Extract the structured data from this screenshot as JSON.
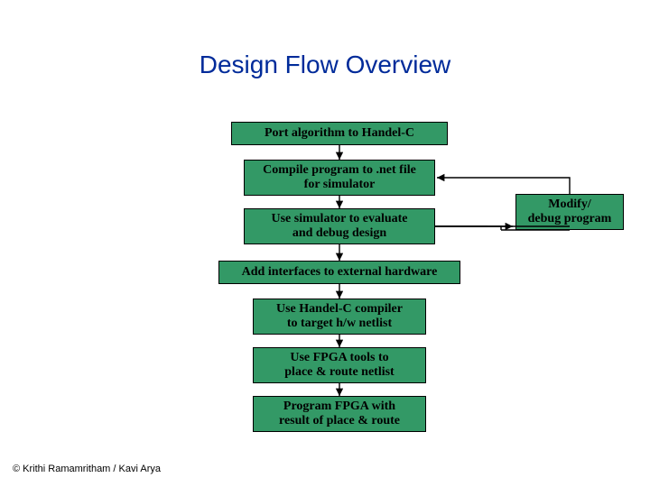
{
  "title": "Design Flow Overview",
  "steps": {
    "s1": "Port algorithm to Handel-C",
    "s2": "Compile program to .net file\nfor simulator",
    "s3": "Use simulator to evaluate\nand debug design",
    "s4": "Add interfaces to external hardware",
    "s5": "Use Handel-C compiler\nto target h/w netlist",
    "s6": "Use FPGA tools to\nplace & route netlist",
    "s7": "Program FPGA with\nresult of place & route"
  },
  "side": "Modify/\ndebug program",
  "footer": "© Krithi Ramamritham / Kavi Arya",
  "chart_data": {
    "type": "diagram",
    "title": "Design Flow Overview",
    "nodes": [
      {
        "id": "s1",
        "label": "Port algorithm to Handel-C"
      },
      {
        "id": "s2",
        "label": "Compile program to .net file for simulator"
      },
      {
        "id": "s3",
        "label": "Use simulator to evaluate and debug design"
      },
      {
        "id": "s4",
        "label": "Add interfaces to external hardware"
      },
      {
        "id": "s5",
        "label": "Use Handel-C compiler to target h/w netlist"
      },
      {
        "id": "s6",
        "label": "Use FPGA tools to place & route netlist"
      },
      {
        "id": "s7",
        "label": "Program FPGA with result of place & route"
      },
      {
        "id": "side",
        "label": "Modify/ debug program"
      }
    ],
    "edges": [
      {
        "from": "s1",
        "to": "s2"
      },
      {
        "from": "s2",
        "to": "s3"
      },
      {
        "from": "s3",
        "to": "s4"
      },
      {
        "from": "s4",
        "to": "s5"
      },
      {
        "from": "s5",
        "to": "s6"
      },
      {
        "from": "s6",
        "to": "s7"
      },
      {
        "from": "s3",
        "to": "side"
      },
      {
        "from": "side",
        "to": "s2"
      }
    ]
  }
}
